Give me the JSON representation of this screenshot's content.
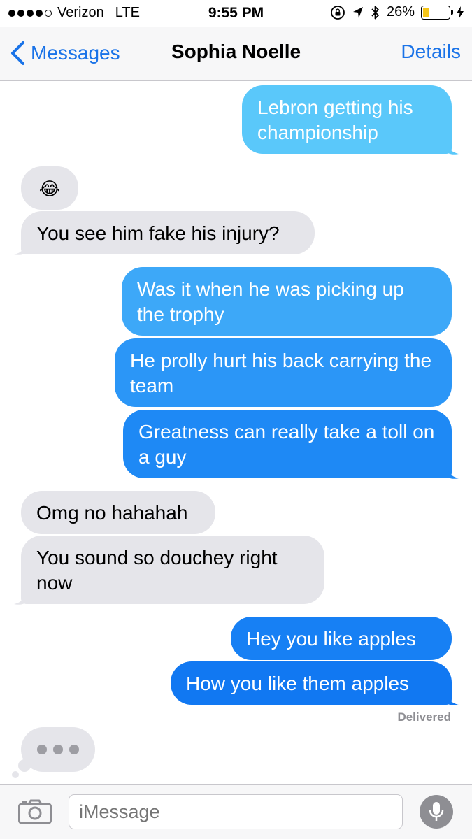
{
  "status_bar": {
    "carrier": "Verizon",
    "network": "LTE",
    "time": "9:55 PM",
    "battery": "26%",
    "battery_level": 0.26
  },
  "nav": {
    "back_label": "Messages",
    "title": "Sophia Noelle",
    "details_label": "Details"
  },
  "messages": [
    {
      "from": "me",
      "text": "Lebron getting his championship"
    },
    {
      "from": "them",
      "text": "😂"
    },
    {
      "from": "them",
      "text": "You see him fake his injury?"
    },
    {
      "from": "me",
      "text": "Was it when he was picking up the trophy"
    },
    {
      "from": "me",
      "text": "He prolly hurt his back carrying the team"
    },
    {
      "from": "me",
      "text": "Greatness can really take a toll on a guy"
    },
    {
      "from": "them",
      "text": "Omg no hahahah"
    },
    {
      "from": "them",
      "text": "You sound so douchey right now"
    },
    {
      "from": "me",
      "text": "Hey you like apples"
    },
    {
      "from": "me",
      "text": "How you like them apples"
    }
  ],
  "delivered_label": "Delivered",
  "composer": {
    "placeholder": "iMessage"
  },
  "colors": {
    "outgoing_top": "#5ac8fa",
    "outgoing_bottom": "#147efb",
    "incoming": "#e5e5ea",
    "accent": "#1a73e8"
  }
}
